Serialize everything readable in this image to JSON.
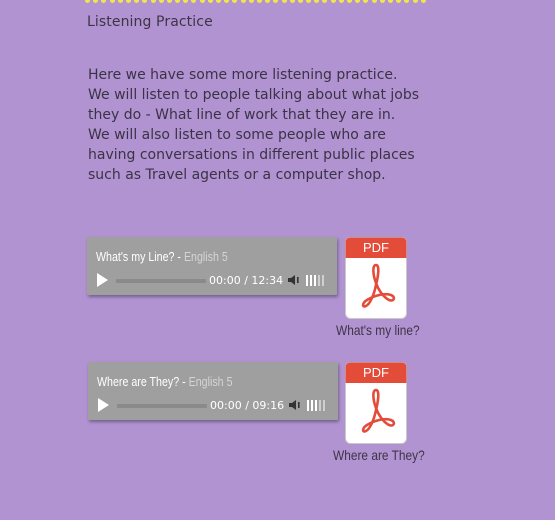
{
  "page": {
    "heading": "Listening Practice",
    "intro_lines": [
      "Here we have some more listening practice.",
      "We will listen to people talking about what jobs",
      "they do - What line of work that they are in.",
      "We will also listen to some people who are",
      "having conversations in different public places",
      "such as Travel agents or a computer shop."
    ]
  },
  "tracks": [
    {
      "title": "What's my Line?",
      "separator": " - ",
      "subtitle": "English 5",
      "time": "00:00 / 12:34",
      "pdf_badge": "PDF",
      "pdf_caption": "What's my line?"
    },
    {
      "title": "Where are They?",
      "separator": " - ",
      "subtitle": "English 5",
      "time": "00:00 / 09:16",
      "pdf_badge": "PDF",
      "pdf_caption": "Where are They?"
    }
  ],
  "colors": {
    "background": "#b193d2",
    "player": "#9f9f9f",
    "pdf_red": "#e44c3a",
    "dots": "#f2e44c"
  }
}
